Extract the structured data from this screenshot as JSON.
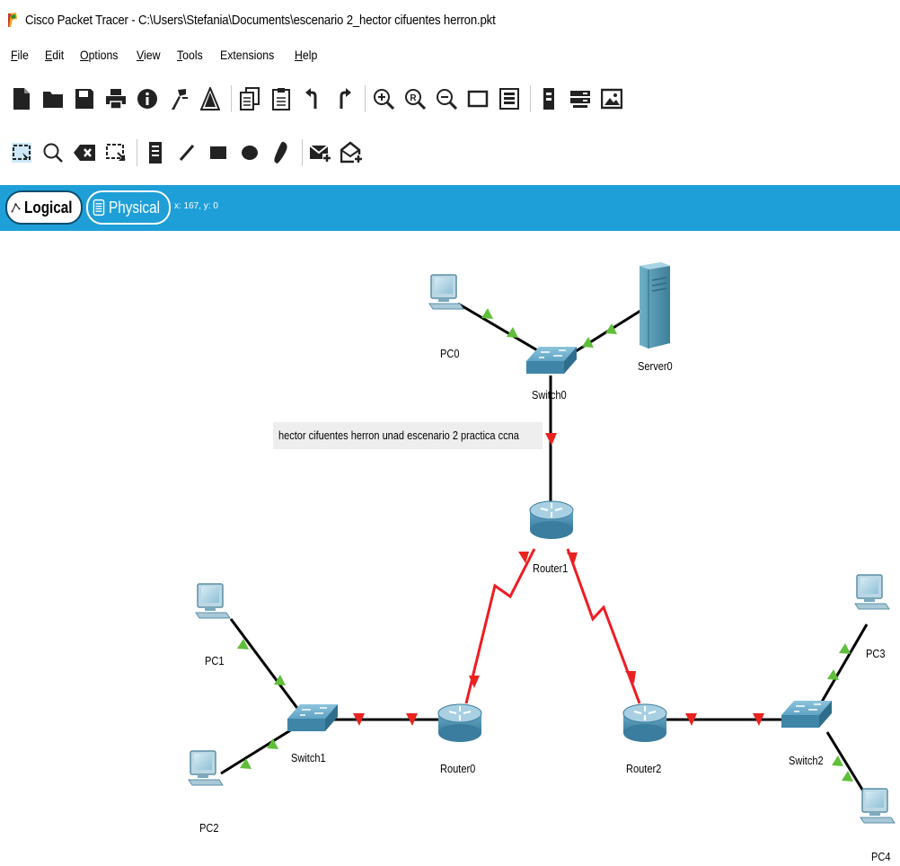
{
  "window": {
    "title": "Cisco Packet Tracer - C:\\Users\\Stefania\\Documents\\escenario 2_hector cifuentes herron.pkt"
  },
  "menu": [
    {
      "mnemonic": "F",
      "rest": "ile"
    },
    {
      "mnemonic": "E",
      "rest": "dit"
    },
    {
      "mnemonic": "O",
      "rest": "ptions"
    },
    {
      "mnemonic": "V",
      "rest": "iew"
    },
    {
      "mnemonic": "T",
      "rest": "ools"
    },
    {
      "mnemonic": "",
      "rest": "Extensions"
    },
    {
      "mnemonic": "H",
      "rest": "elp"
    }
  ],
  "tabs": {
    "logical": "Logical",
    "physical": "Physical",
    "coords": "x: 167, y: 0"
  },
  "note": "hector cifuentes herron unad escenario 2 practica ccna",
  "devices": {
    "pc0": "PC0",
    "server0": "Server0",
    "switch0": "Switch0",
    "router1": "Router1",
    "pc1": "PC1",
    "pc2": "PC2",
    "switch1": "Switch1",
    "router0": "Router0",
    "router2": "Router2",
    "switch2": "Switch2",
    "pc3": "PC3",
    "pc4": "PC4"
  },
  "colors": {
    "tab_strip": "#1e9fd7",
    "link_ethernet": "#000000",
    "link_serial": "#ee1c24",
    "port_up": "#5fbf3a",
    "port_down": "#e8231f",
    "device": "#4f94b8"
  }
}
